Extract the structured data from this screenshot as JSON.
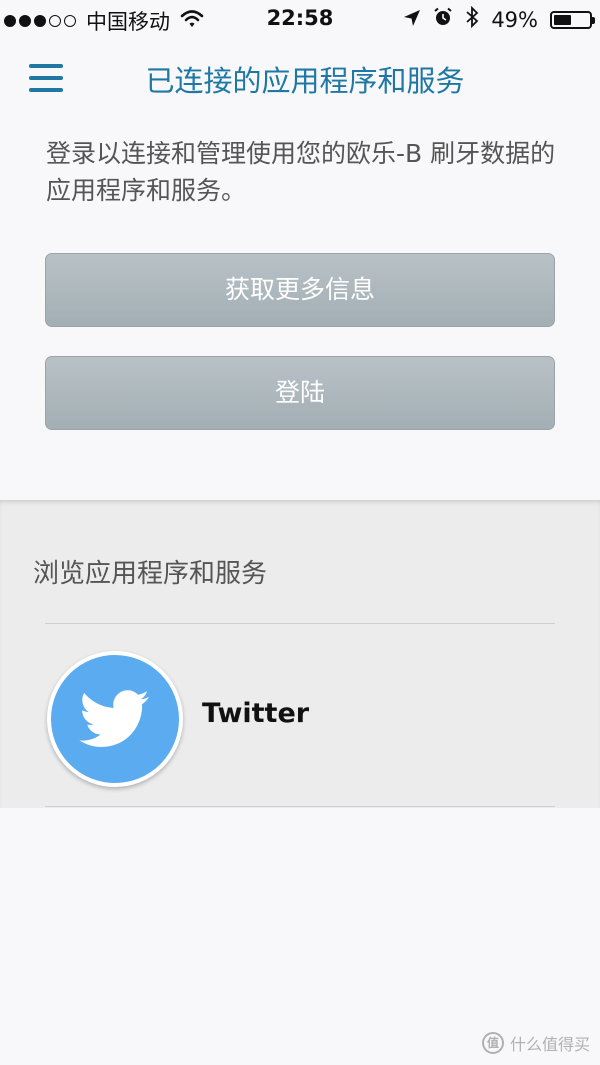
{
  "status_bar": {
    "carrier": "中国移动",
    "time": "22:58",
    "battery_percent": "49%",
    "battery_level": 0.49,
    "icons": [
      "wifi-icon",
      "location-arrow-icon",
      "alarm-icon",
      "bluetooth-icon",
      "battery-icon"
    ]
  },
  "header": {
    "title": "已连接的应用程序和服务",
    "menu_icon": "hamburger-menu-icon"
  },
  "intro": {
    "text": "登录以连接和管理使用您的欧乐-B 刷牙数据的应用程序和服务。"
  },
  "buttons": {
    "more_info": "获取更多信息",
    "login": "登陆"
  },
  "browse": {
    "title": "浏览应用程序和服务",
    "services": [
      {
        "name": "Twitter",
        "icon": "twitter-bird-icon"
      }
    ]
  },
  "watermark": {
    "text": "什么值得买",
    "badge": "值"
  },
  "colors": {
    "accent": "#1f78a4",
    "button": "#a9b4ba",
    "twitter": "#5aabf0",
    "section_bg": "#ececec"
  }
}
